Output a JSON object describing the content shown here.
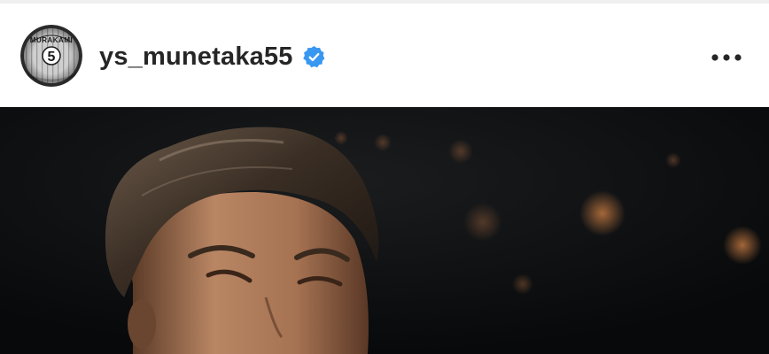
{
  "post": {
    "username": "ys_munetaka55",
    "verified": true,
    "avatar": {
      "icon": "profile-picture",
      "jersey_name": "MURAKAMI",
      "jersey_number": "5"
    },
    "more_icon": "more-horizontal-icon",
    "photo_icon": "post-photo"
  },
  "colors": {
    "verified_blue": "#3897f0",
    "username_text": "#262626",
    "photo_background": "#0a0c0e"
  }
}
